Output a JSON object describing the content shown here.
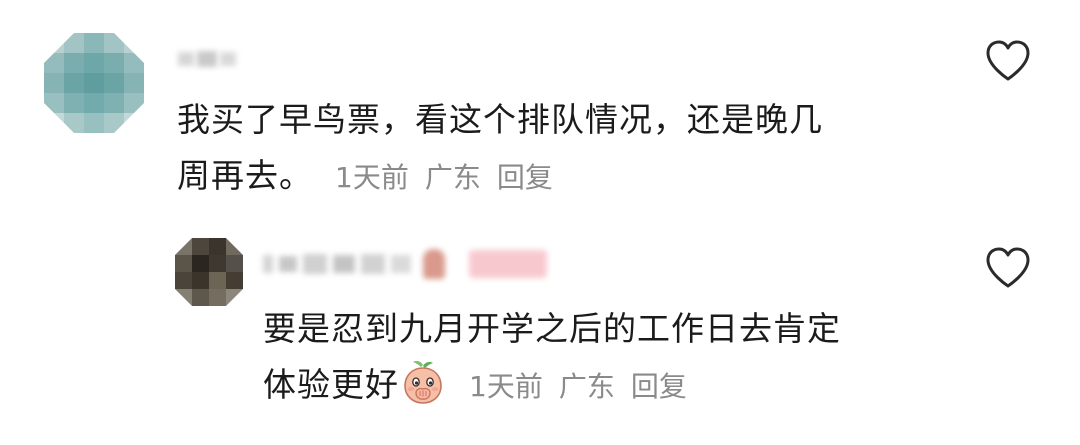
{
  "comments": [
    {
      "username": "",
      "text_line1": "我买了早鸟票，看这个排队情况，还是晚几",
      "text_line2": "周再去。",
      "time": "1天前",
      "location": "广东",
      "reply_label": "回复",
      "avatar_icon": "pixelated-avatar-icon",
      "like_icon": "heart-outline-icon",
      "liked": false
    },
    {
      "username": "",
      "text_line1": "要是忍到九月开学之后的工作日去肯定",
      "text_line2": "体验更好",
      "time": "1天前",
      "location": "广东",
      "reply_label": "回复",
      "avatar_icon": "pixelated-avatar-icon",
      "emoji_icon": "peach-face-covering-mouth-emoji-icon",
      "like_icon": "heart-outline-icon",
      "liked": false,
      "is_reply": true
    }
  ],
  "colors": {
    "text": "#1b1b1b",
    "meta": "#8a8a8a",
    "heart_stroke": "#2b2b2b",
    "badge_pink": "#f7c9cf"
  }
}
